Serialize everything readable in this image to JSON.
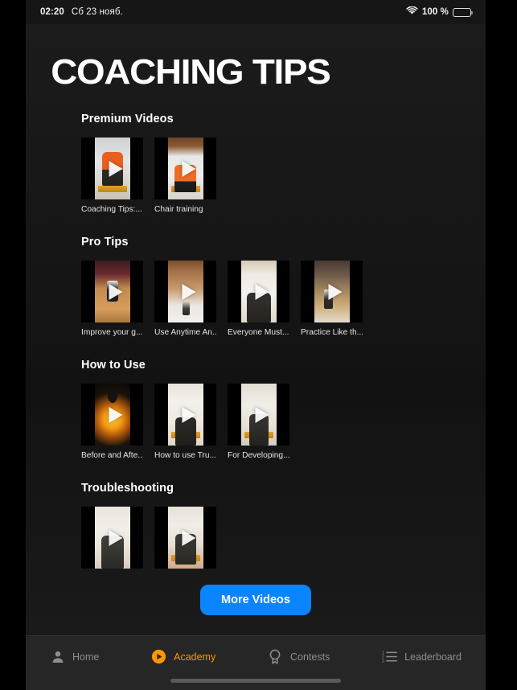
{
  "status_bar": {
    "time": "02:20",
    "date": "Сб 23 нояб.",
    "battery_percent": "100 %",
    "wifi_icon": "wifi-icon",
    "battery_icon": "battery-icon"
  },
  "header": {
    "title": "COACHING TIPS"
  },
  "colors": {
    "accent_blue": "#0A84FF",
    "accent_orange": "#FF9500",
    "background": "#161616",
    "tabbar": "#262626"
  },
  "sections": [
    {
      "title": "Premium Videos",
      "videos": [
        {
          "caption": "Coaching Tips:...",
          "art": "sc-gym",
          "play_icon": "play-icon",
          "strip": true
        },
        {
          "caption": "Chair training",
          "art": "sc-chair",
          "play_icon": "play-icon",
          "strip": true
        }
      ]
    },
    {
      "title": "Pro Tips",
      "videos": [
        {
          "caption": "Improve your g...",
          "art": "sc-court",
          "play_icon": "play-icon",
          "strip": false
        },
        {
          "caption": "Use Anytime An...",
          "art": "sc-ceiling",
          "play_icon": "play-icon",
          "strip": false
        },
        {
          "caption": "Everyone Must...",
          "art": "sc-hoop",
          "play_icon": "play-icon",
          "strip": false
        },
        {
          "caption": "Practice Like th...",
          "art": "sc-arena",
          "play_icon": "play-icon",
          "strip": false
        }
      ]
    },
    {
      "title": "How to Use",
      "videos": [
        {
          "caption": "Before and Afte...",
          "art": "sc-fire",
          "play_icon": "play-icon",
          "strip": false
        },
        {
          "caption": "How to use Tru...",
          "art": "sc-truhoop",
          "play_icon": "play-icon",
          "strip": true
        },
        {
          "caption": "For Developing...",
          "art": "sc-develop",
          "play_icon": "play-icon",
          "strip": true
        }
      ]
    },
    {
      "title": "Troubleshooting",
      "videos": [
        {
          "caption": "",
          "art": "sc-trouble1",
          "play_icon": "play-icon",
          "strip": false
        },
        {
          "caption": "",
          "art": "sc-trouble2",
          "play_icon": "play-icon",
          "strip": true
        }
      ]
    }
  ],
  "more_button": {
    "label": "More Videos"
  },
  "tabbar": {
    "items": [
      {
        "label": "Home",
        "icon": "person-icon",
        "active": false
      },
      {
        "label": "Academy",
        "icon": "play-circle-icon",
        "active": true
      },
      {
        "label": "Contests",
        "icon": "award-ribbon-icon",
        "active": false
      },
      {
        "label": "Leaderboard",
        "icon": "numbered-list-icon",
        "active": false
      }
    ]
  }
}
